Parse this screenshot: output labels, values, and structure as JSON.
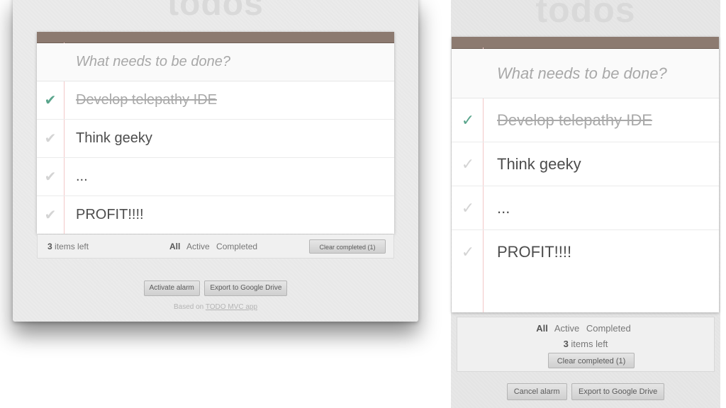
{
  "desktop": {
    "title": "todos",
    "new_todo_placeholder": "What needs to be done?",
    "todos": [
      {
        "label": "Develop telepathy IDE",
        "completed": true
      },
      {
        "label": "Think geeky",
        "completed": false
      },
      {
        "label": "...",
        "completed": false
      },
      {
        "label": "PROFIT!!!!",
        "completed": false
      }
    ],
    "footer": {
      "count_number": "3",
      "count_suffix": " items left",
      "filters": [
        {
          "label": "All",
          "selected": true
        },
        {
          "label": "Active",
          "selected": false
        },
        {
          "label": "Completed",
          "selected": false
        }
      ],
      "clear_label": "Clear completed (1)"
    },
    "actions": {
      "alarm_label": "Activate alarm",
      "export_label": "Export to Google Drive"
    },
    "credit": {
      "prefix": "Based on ",
      "link": "TODO MVC app"
    }
  },
  "mobile": {
    "title": "todos",
    "new_todo_placeholder": "What needs to be done?",
    "todos": [
      {
        "label": "Develop telepathy IDE",
        "completed": true
      },
      {
        "label": "Think geeky",
        "completed": false
      },
      {
        "label": "...",
        "completed": false
      },
      {
        "label": "PROFIT!!!!",
        "completed": false
      }
    ],
    "footer": {
      "filters": [
        {
          "label": "All",
          "selected": true
        },
        {
          "label": "Active",
          "selected": false
        },
        {
          "label": "Completed",
          "selected": false
        }
      ],
      "count_number": "3",
      "count_suffix": " items left",
      "clear_label": "Clear completed (1)"
    },
    "actions": {
      "alarm_label": "Cancel alarm",
      "export_label": "Export to Google Drive"
    }
  },
  "icons": {
    "check": "check-icon"
  },
  "colors": {
    "accent_check": "#5aa58c",
    "header_bar": "#8c7a70",
    "title": "#d9d9d9"
  }
}
